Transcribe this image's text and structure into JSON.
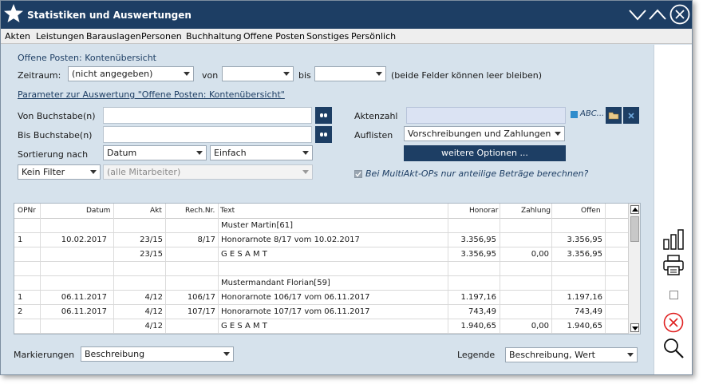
{
  "window": {
    "title": "Statistiken und Auswertungen"
  },
  "menu": [
    "Akten",
    "Leistungen",
    "Barauslagen",
    "Personen",
    "Buchhaltung",
    "Offene Posten",
    "Sonstiges",
    "Persönlich"
  ],
  "form": {
    "section_title": "Offene Posten: Kontenübersicht",
    "zeitraum_label": "Zeitraum:",
    "zeitraum_value": "(nicht angegeben)",
    "von_label": "von",
    "von_value": "",
    "bis_label": "bis",
    "bis_value": "",
    "zeitraum_hint": "(beide Felder können leer bleiben)",
    "parameter_link": "Parameter zur Auswertung \"Offene Posten: Kontenübersicht\"",
    "von_buchstabe_label": "Von Buchstabe(n)",
    "von_buchstabe_value": "",
    "bis_buchstabe_label": "Bis Buchstabe(n)",
    "bis_buchstabe_value": "",
    "sortierung_label": "Sortierung nach",
    "sortierung_value": "Datum",
    "sortierung_mode_value": "Einfach",
    "filter_value": "Kein Filter",
    "mitarbeiter_value": "(alle Mitarbeiter)",
    "aktenzahl_label": "Aktenzahl",
    "aktenzahl_value": "",
    "abc_label": "ABC...",
    "auflisten_label": "Auflisten",
    "auflisten_value": "Vorschreibungen und Zahlungen",
    "weitere_optionen_label": "weitere Optionen ...",
    "multiakt_label": "Bei MultiAkt-OPs nur anteilige Beträge berechnen?",
    "multiakt_checked": true
  },
  "table": {
    "columns": [
      "OPNr",
      "Datum",
      "Akt",
      "Rech.Nr.",
      "Text",
      "Honorar",
      "Zahlung",
      "Offen"
    ],
    "rows": [
      {
        "opnr": "",
        "datum": "",
        "akt": "",
        "rech": "",
        "text": "Muster Martin[61]",
        "honorar": "",
        "zahlung": "",
        "offen": ""
      },
      {
        "opnr": "1",
        "datum": "10.02.2017",
        "akt": "23/15",
        "rech": "8/17",
        "text": "Honorarnote 8/17 vom 10.02.2017",
        "honorar": "3.356,95",
        "zahlung": "",
        "offen": "3.356,95"
      },
      {
        "opnr": "",
        "datum": "",
        "akt": "23/15",
        "rech": "",
        "text": "G E S A M T",
        "honorar": "3.356,95",
        "zahlung": "0,00",
        "offen": "3.356,95"
      },
      {
        "opnr": "",
        "datum": "",
        "akt": "",
        "rech": "",
        "text": "",
        "honorar": "",
        "zahlung": "",
        "offen": ""
      },
      {
        "opnr": "",
        "datum": "",
        "akt": "",
        "rech": "",
        "text": "Mustermandant Florian[59]",
        "honorar": "",
        "zahlung": "",
        "offen": ""
      },
      {
        "opnr": "1",
        "datum": "06.11.2017",
        "akt": "4/12",
        "rech": "106/17",
        "text": "Honorarnote 106/17 vom 06.11.2017",
        "honorar": "1.197,16",
        "zahlung": "",
        "offen": "1.197,16"
      },
      {
        "opnr": "2",
        "datum": "06.11.2017",
        "akt": "4/12",
        "rech": "107/17",
        "text": "Honorarnote 107/17 vom 06.11.2017",
        "honorar": "743,49",
        "zahlung": "",
        "offen": "743,49"
      },
      {
        "opnr": "",
        "datum": "",
        "akt": "4/12",
        "rech": "",
        "text": "G E S A M T",
        "honorar": "1.940,65",
        "zahlung": "0,00",
        "offen": "1.940,65"
      }
    ]
  },
  "footer": {
    "markierungen_label": "Markierungen",
    "markierungen_value": "Beschreibung",
    "legende_label": "Legende",
    "legende_value": "Beschreibung, Wert"
  },
  "icons": {
    "logo": "star-icon",
    "minimize": "chevron-down-icon",
    "maximize": "chevron-up-icon",
    "close": "close-circle-icon",
    "chart": "bar-chart-icon",
    "print": "printer-icon",
    "checkbox": "checkbox-icon",
    "cancel": "cancel-icon",
    "search": "magnifier-icon"
  },
  "colors": {
    "titlebar": "#1d3e64",
    "background": "#d6e2ec",
    "accent": "#1d3e64",
    "cancel": "#e02020"
  }
}
